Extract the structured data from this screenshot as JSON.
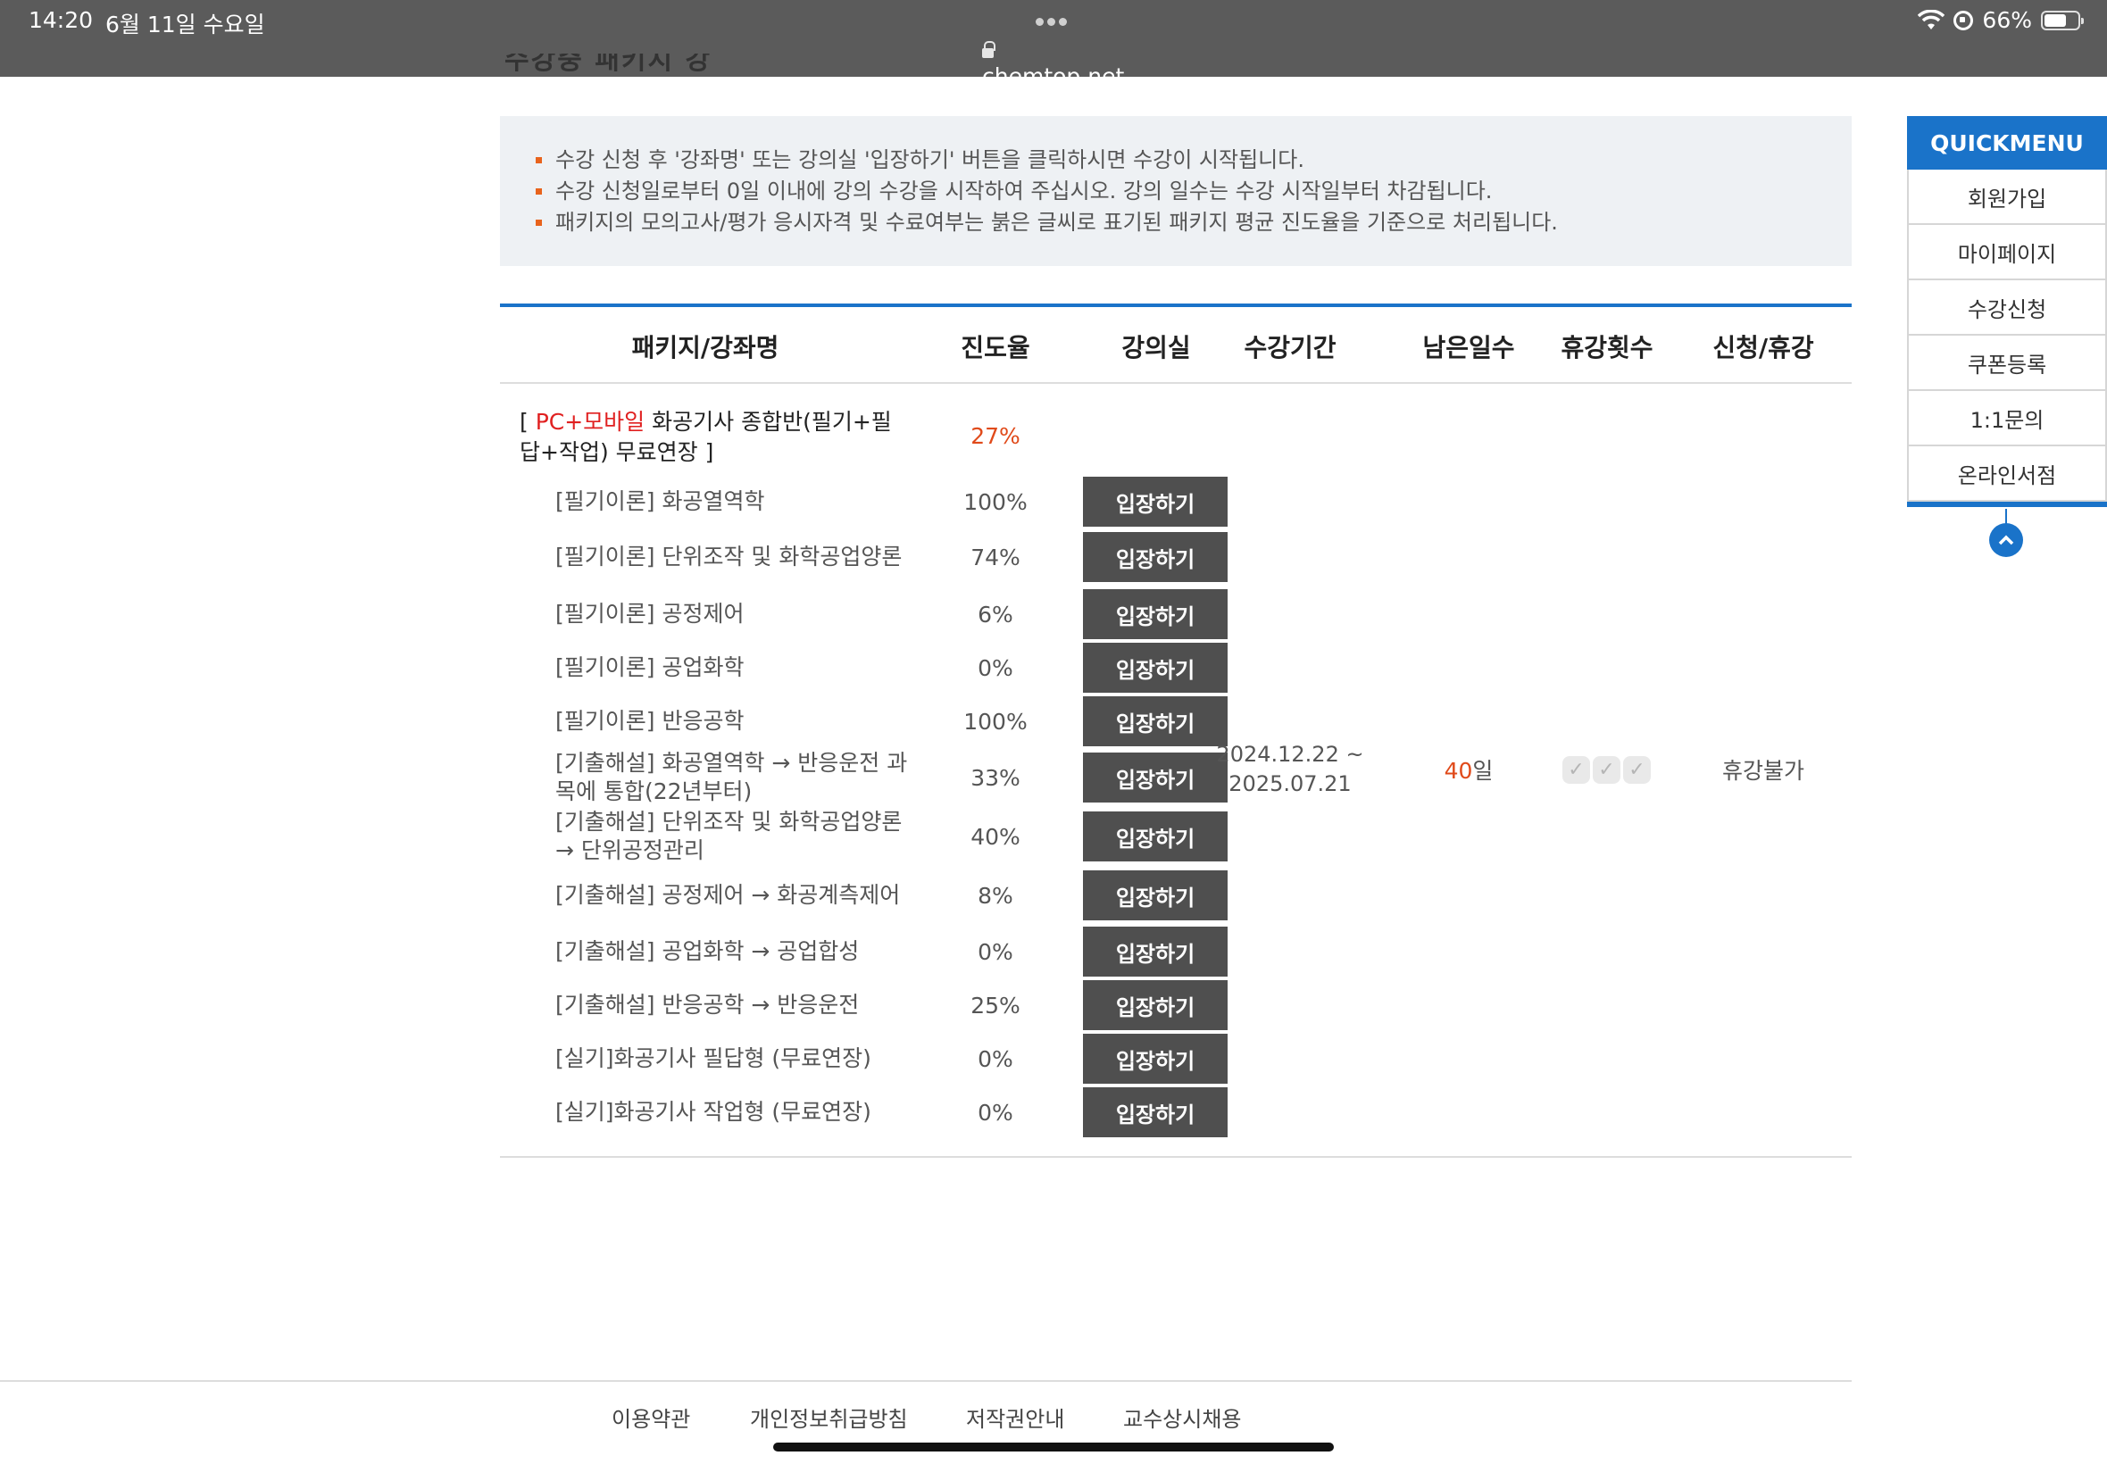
{
  "statusbar": {
    "time": "14:20",
    "date": "6월 11일 수요일",
    "url": "chemtop.net",
    "battery": "66%",
    "battery_level": 0.66
  },
  "page": {
    "cutoff_title": "수강중 패키지 강좌"
  },
  "notice": [
    "수강 신청 후 '강좌명' 또는 강의실 '입장하기' 버튼을 클릭하시면 수강이 시작됩니다.",
    "수강 신청일로부터 0일 이내에 강의 수강을 시작하여 주십시오. 강의 일수는 수강 시작일부터 차감됩니다.",
    "패키지의 모의고사/평가 응시자격 및 수료여부는 붉은 글씨로 표기된 패키지 평균 진도율을 기준으로 처리됩니다."
  ],
  "table": {
    "headers": [
      "패키지/강좌명",
      "진도율",
      "강의실",
      "수강기간",
      "남은일수",
      "휴강횟수",
      "신청/휴강"
    ],
    "package": {
      "prefix": "[ ",
      "badge": "PC+모바일",
      "title": " 화공기사 종합반(필기+필답+작업) 무료연장 ]",
      "rate": "27%",
      "period": "2024.12.22 ~\n2025.07.21",
      "remain_num": "40",
      "remain_unit": "일",
      "checks": [
        "✓",
        "✓",
        "✓"
      ],
      "leave": "휴강불가"
    },
    "enter_label": "입장하기",
    "courses": [
      {
        "name": "[필기이론] 화공열역학",
        "rate": "100%"
      },
      {
        "name": "[필기이론] 단위조작 및 화학공업양론",
        "rate": "74%"
      },
      {
        "name": "[필기이론] 공정제어",
        "rate": "6%"
      },
      {
        "name": "[필기이론] 공업화학",
        "rate": "0%"
      },
      {
        "name": "[필기이론] 반응공학",
        "rate": "100%"
      },
      {
        "name": "[기출해설] 화공열역학 → 반응운전 과목에 통합(22년부터)",
        "rate": "33%"
      },
      {
        "name": "[기출해설] 단위조작 및 화학공업양론 → 단위공정관리",
        "rate": "40%"
      },
      {
        "name": "[기출해설] 공정제어 → 화공계측제어",
        "rate": "8%"
      },
      {
        "name": "[기출해설] 공업화학 → 공업합성",
        "rate": "0%"
      },
      {
        "name": "[기출해설] 반응공학 → 반응운전",
        "rate": "25%"
      },
      {
        "name": "[실기]화공기사 필답형 (무료연장)",
        "rate": "0%"
      },
      {
        "name": "[실기]화공기사 작업형 (무료연장)",
        "rate": "0%"
      }
    ]
  },
  "quickmenu": {
    "title": "QUICKMENU",
    "items": [
      "회원가입",
      "마이페이지",
      "수강신청",
      "쿠폰등록",
      "1:1문의",
      "온라인서점"
    ],
    "top_icon": "chevron-up-icon"
  },
  "footer": {
    "links": [
      "이용약관",
      "개인정보취급방침",
      "저작권안내",
      "교수상시채용"
    ]
  },
  "colors": {
    "accent": "#1a73c9",
    "highlight": "#e04a1a",
    "button": "#4f4f4f"
  }
}
